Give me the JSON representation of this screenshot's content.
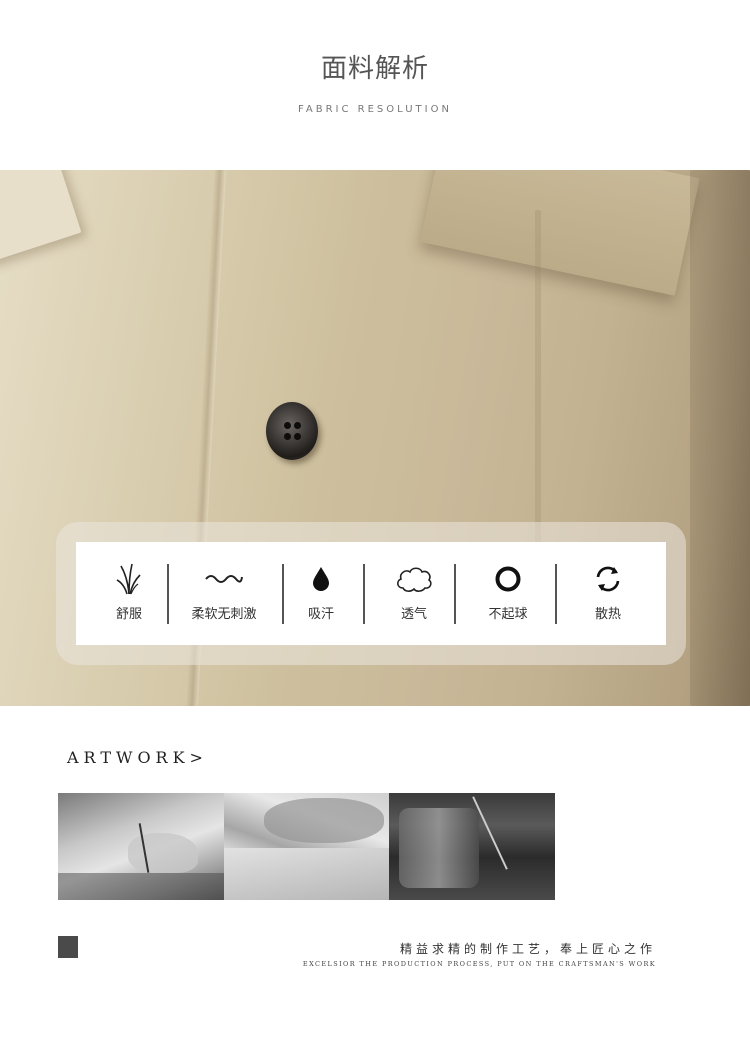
{
  "header": {
    "title": "面料解析",
    "subtitle": "FABRIC RESOLUTION"
  },
  "features": [
    {
      "label": "舒服",
      "icon": "grass-icon"
    },
    {
      "label": "柔软无刺激",
      "icon": "wave-icon"
    },
    {
      "label": "吸汗",
      "icon": "droplet-icon"
    },
    {
      "label": "透气",
      "icon": "cloud-icon"
    },
    {
      "label": "不起球",
      "icon": "ring-icon"
    },
    {
      "label": "散热",
      "icon": "refresh-icon"
    }
  ],
  "artwork": {
    "title": "ARTWORK>",
    "slogan_cn": "精益求精的制作工艺，奉上匠心之作",
    "slogan_en": "EXCELSIOR THE PRODUCTION PROCESS, PUT ON THE CRAFTSMAN'S WORK"
  },
  "colors": {
    "fabric": "#cdbf9d",
    "icon": "#222222",
    "square": "#4a4a4a"
  }
}
